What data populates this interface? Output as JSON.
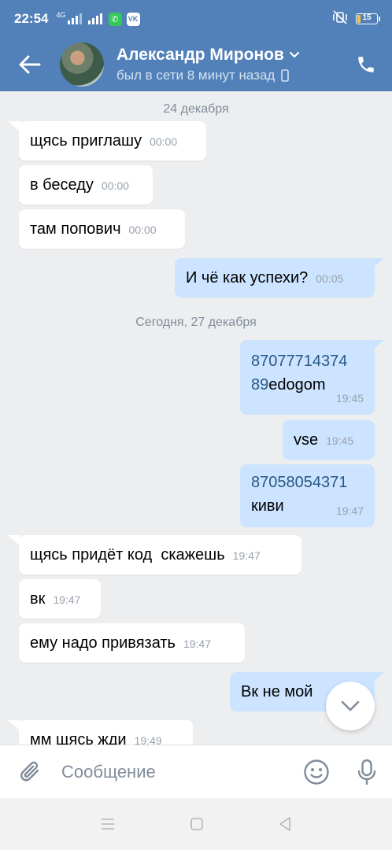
{
  "status_bar": {
    "time": "22:54",
    "network": "4G",
    "vk_label": "VK",
    "battery": "15"
  },
  "header": {
    "name": "Александр Миронов",
    "status": "был в сети 8 минут назад"
  },
  "messages": {
    "date_1": "24 декабря",
    "m1": {
      "text": "щясь приглашу",
      "time": "00:00"
    },
    "m2": {
      "text": "в беседу",
      "time": "00:00"
    },
    "m3": {
      "text": "там попович",
      "time": "00:00"
    },
    "m4": {
      "text": "И чё как успехи?",
      "time": "00:05"
    },
    "date_2": "Сегодня, 27 декабря",
    "m5": {
      "line1_link": "87077714374",
      "line2_link": "89",
      "line2_text": "edogom",
      "time": "19:45"
    },
    "m6": {
      "text": "vse",
      "time": "19:45"
    },
    "m7": {
      "line1_link": "87058054371",
      "line2_text": "киви",
      "time": "19:47"
    },
    "m8": {
      "text": "щясь придёт код  скажешь",
      "time": "19:47"
    },
    "m9": {
      "text": "вк",
      "time": "19:47"
    },
    "m10": {
      "text": "ему надо привязать",
      "time": "19:47"
    },
    "m11": {
      "text": "Вк не мой"
    },
    "m12": {
      "text": "мм щясь жди",
      "time": "19:49"
    }
  },
  "composer": {
    "placeholder": "Сообщение"
  },
  "colors": {
    "header_bg": "#5181b8",
    "incoming_bubble": "#ffffff",
    "outgoing_bubble": "#cce4ff",
    "link": "#2a5885",
    "chat_bg": "#edeef0"
  },
  "icons": [
    "back-arrow-icon",
    "chevron-down-icon",
    "phone-icon",
    "mobile-device-icon",
    "scroll-down-chevron-icon",
    "attach-clip-icon",
    "emoji-icon",
    "microphone-icon",
    "nav-menu-icon",
    "nav-home-icon",
    "nav-back-icon"
  ]
}
